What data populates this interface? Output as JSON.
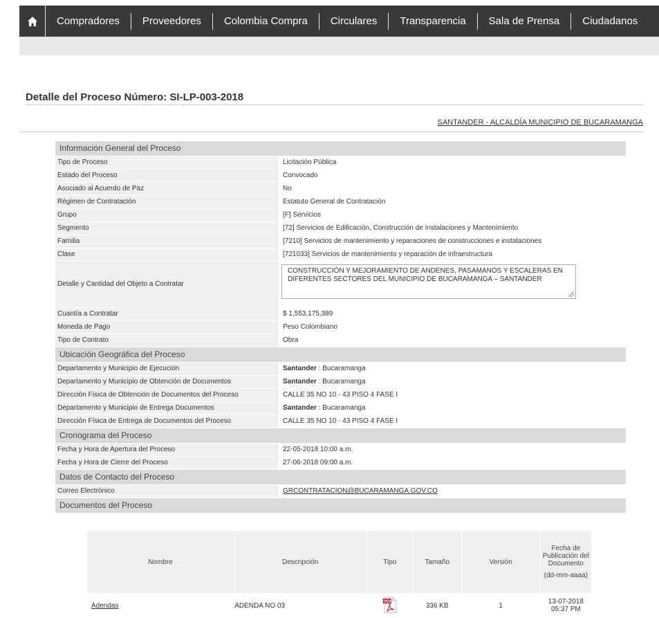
{
  "nav": {
    "items": [
      "Compradores",
      "Proveedores",
      "Colombia Compra",
      "Circulares",
      "Transparencia",
      "Sala de Prensa",
      "Ciudadanos"
    ]
  },
  "page": {
    "title": "Detalle del Proceso Número: SI-LP-003-2018",
    "entity": "SANTANDER - ALCALDÍA MUNICIPIO DE BUCARAMANGA"
  },
  "general": {
    "heading": "Información General del Proceso",
    "rows": [
      {
        "label": "Tipo de Proceso",
        "value": "Licitación Pública"
      },
      {
        "label": "Estado del Proceso",
        "value": "Convocado"
      },
      {
        "label": "Asociado al Acuerdo de Paz",
        "value": "No"
      },
      {
        "label": "Régimen de Contratación",
        "value": "Estatuto General de Contratación"
      },
      {
        "label": "Grupo",
        "value": "[F] Servicios"
      },
      {
        "label": "Segmento",
        "value": "[72] Servicios de Edificación, Construcción de Instalaciones y Mantenimiento"
      },
      {
        "label": "Familia",
        "value": "[7210] Servicios de mantenimiento y reparaciones de construcciones e instalaciones"
      },
      {
        "label": "Clase",
        "value": "[721033] Servicios de mantenimiento y reparación de infraestructura"
      }
    ],
    "objeto": {
      "label": "Detalle y Cantidad del Objeto a Contratar",
      "value": "CONSTRUCCIÓN Y MEJORAMIENTO DE ANDENES, PASAMANOS Y ESCALERAS EN DIFERENTES SECTORES DEL MUNICIPIO DE BUCARAMANGA – SANTANDER"
    },
    "rows2": [
      {
        "label": "Cuantía a Contratar",
        "value": "$ 1,553,175,389"
      },
      {
        "label": "Moneda de Pago",
        "value": "Peso Colombiano"
      },
      {
        "label": "Tipo de Contrato",
        "value": "Obra"
      }
    ]
  },
  "ubicacion": {
    "heading": "Ubicación Geográfica del Proceso",
    "rows": [
      {
        "label": "Departamento y Municipio de Ejecución",
        "dept": "Santander",
        "rest": " : Bucaramanga"
      },
      {
        "label": "Departamento y Municipio de Obtención de Documentos",
        "dept": "Santander",
        "rest": " : Bucaramanga"
      },
      {
        "label": "Dirección Física de Obtención de Documentos del Proceso",
        "value": "CALLE 35 NO 10 - 43 PISO 4 FASE I"
      },
      {
        "label": "Departamento y Municipio de Entrega Documentos",
        "dept": "Santander",
        "rest": " : Bucaramanga"
      },
      {
        "label": "Dirección Física de Entrega de Documentos del Proceso",
        "value": "CALLE 35 NO 10 - 43 PISO 4 FASE I"
      }
    ]
  },
  "cronograma": {
    "heading": "Cronograma del Proceso",
    "rows": [
      {
        "label": "Fecha y Hora de Apertura del Proceso",
        "value": "22-05-2018 10:00 a.m."
      },
      {
        "label": "Fecha y Hora de Cierre del Proceso",
        "value": "27-06-2018 09:00 a.m."
      }
    ]
  },
  "contacto": {
    "heading": "Datos de Contacto del Proceso",
    "email_label": "Correo Electrónico",
    "email": "GRCONTRATACION@BUCARAMANGA.GOV.CO"
  },
  "documentos": {
    "heading": "Documentos del Proceso",
    "columns": {
      "nombre": "Nombre",
      "descripcion": "Descripción",
      "tipo": "Tipo",
      "tamano": "Tamaño",
      "version": "Versión",
      "fecha_1": "Fecha de Publicación del Documento",
      "fecha_2": "(dd-mm-aaaa)"
    },
    "rows": [
      {
        "nombre": "Adendas",
        "descripcion": "ADENDA NO 03",
        "tipo": "pdf-icon",
        "tamano": "336 KB",
        "version": "1",
        "fecha": "13-07-2018",
        "hora": "05:37 PM"
      }
    ]
  }
}
